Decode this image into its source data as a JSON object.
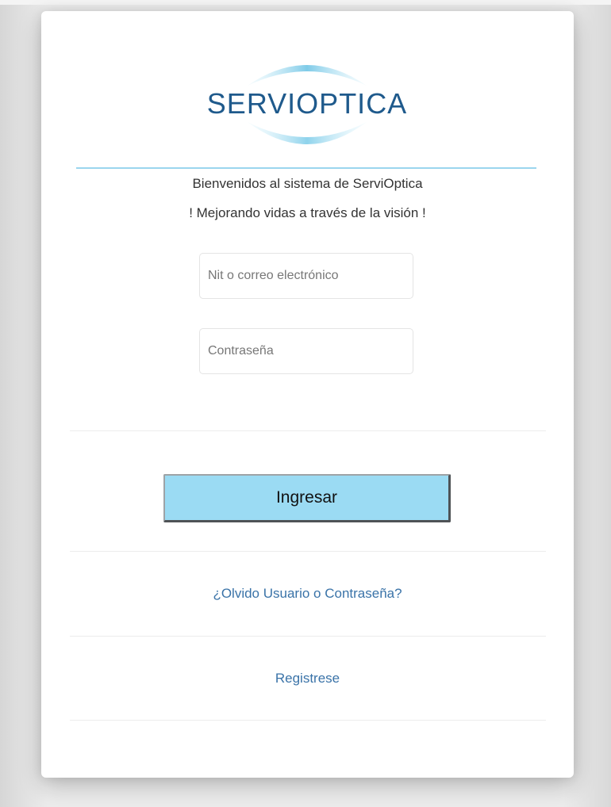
{
  "logo": {
    "text": "SERVIOPTICA",
    "text_color": "#1f5a8c",
    "arc_color": "#8fd3ec"
  },
  "welcome": {
    "line1": "Bienvenidos al sistema de ServiOptica",
    "line2": "! Mejorando vidas a través de la visión !"
  },
  "form": {
    "user_placeholder": "Nit o correo electrónico",
    "user_value": "",
    "password_placeholder": "Contraseña",
    "password_value": "",
    "submit_label": "Ingresar"
  },
  "links": {
    "forgot": "¿Olvido Usuario o Contraseña?",
    "register": "Registrese"
  },
  "colors": {
    "accent": "#9bdbf3",
    "link": "#3a73a8",
    "rule": "#9bd6ee"
  }
}
